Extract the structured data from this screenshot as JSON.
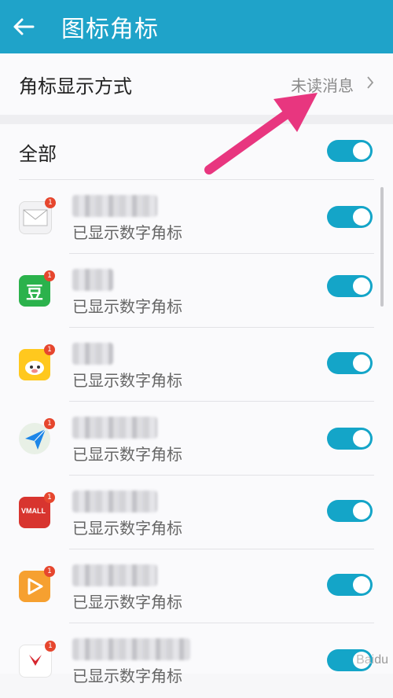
{
  "header": {
    "title": "图标角标"
  },
  "badge_mode": {
    "label": "角标显示方式",
    "value": "未读消息"
  },
  "all": {
    "label": "全部",
    "enabled": true
  },
  "apps": [
    {
      "icon": "mail-icon",
      "badge": "1",
      "status": "已显示数字角标",
      "enabled": true
    },
    {
      "icon": "douban-icon",
      "badge": "1",
      "status": "已显示数字角标",
      "enabled": true
    },
    {
      "icon": "fliggy-icon",
      "badge": "1",
      "status": "已显示数字角标",
      "enabled": true
    },
    {
      "icon": "navigation-icon",
      "badge": "1",
      "status": "已显示数字角标",
      "enabled": true
    },
    {
      "icon": "vmall-icon",
      "badge": "1",
      "status": "已显示数字角标",
      "enabled": true
    },
    {
      "icon": "video-icon",
      "badge": "1",
      "status": "已显示数字角标",
      "enabled": true
    },
    {
      "icon": "huawei-icon",
      "badge": "1",
      "status": "已显示数字角标",
      "enabled": true
    }
  ],
  "labels": {
    "vmall": "VMALL",
    "douban": "豆"
  },
  "colors": {
    "header": "#1fa3c9",
    "toggle_on": "#14a5c8",
    "arrow": "#e8367f",
    "badge": "#e6462e"
  }
}
